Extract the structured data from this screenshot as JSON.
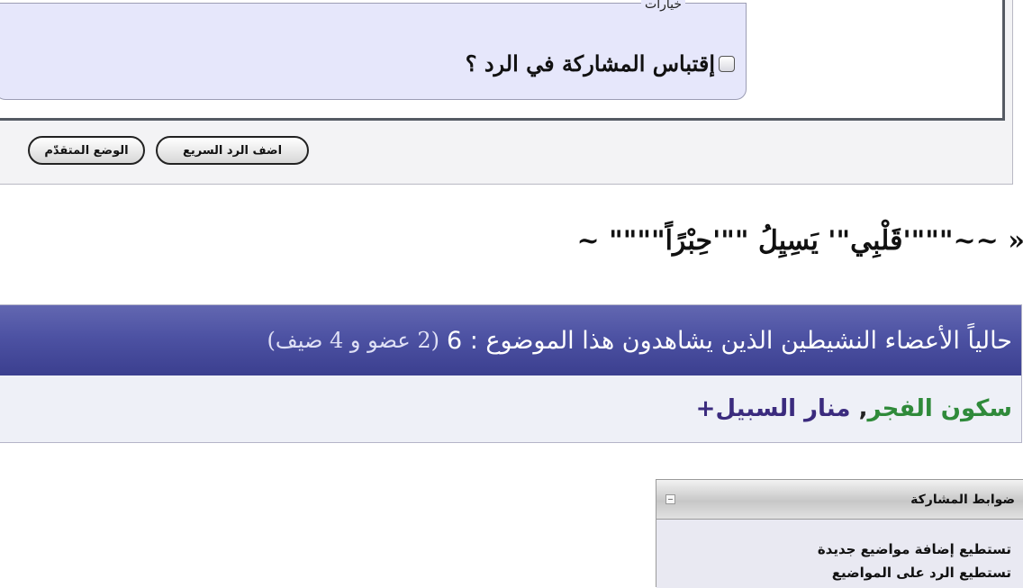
{
  "reply_form": {
    "options_legend": "خيارات",
    "quote_label": "إقتباس المشاركة في الرد ؟",
    "quick_reply_button": "اضف الرد السريع",
    "advanced_button": "الوضع المتقدّم"
  },
  "signature": {
    "text": "« ~~\"\"\"'قََلْبِي\"' يَسِيِلُ \"\"'حِبْرًاً\"\"\"\" ~"
  },
  "active_users": {
    "title": "حالياً الأعضاء النشيطين الذين يشاهدون هذا الموضوع : 6",
    "breakdown": "(2 عضو و 4 ضيف)",
    "users": [
      "سكون الفجر",
      "منار السبيل+"
    ],
    "separator": ",",
    "colors": {
      "user1": "#2f8a3a",
      "user2": "#3b2b7e",
      "header": "#4d52a3"
    }
  },
  "posting_rules": {
    "title": "ضوابط المشاركة",
    "collapse_icon": "collapse-icon",
    "items": [
      "تستطيع إضافة مواضيع جديدة",
      "تستطيع الرد على المواضيع"
    ]
  }
}
